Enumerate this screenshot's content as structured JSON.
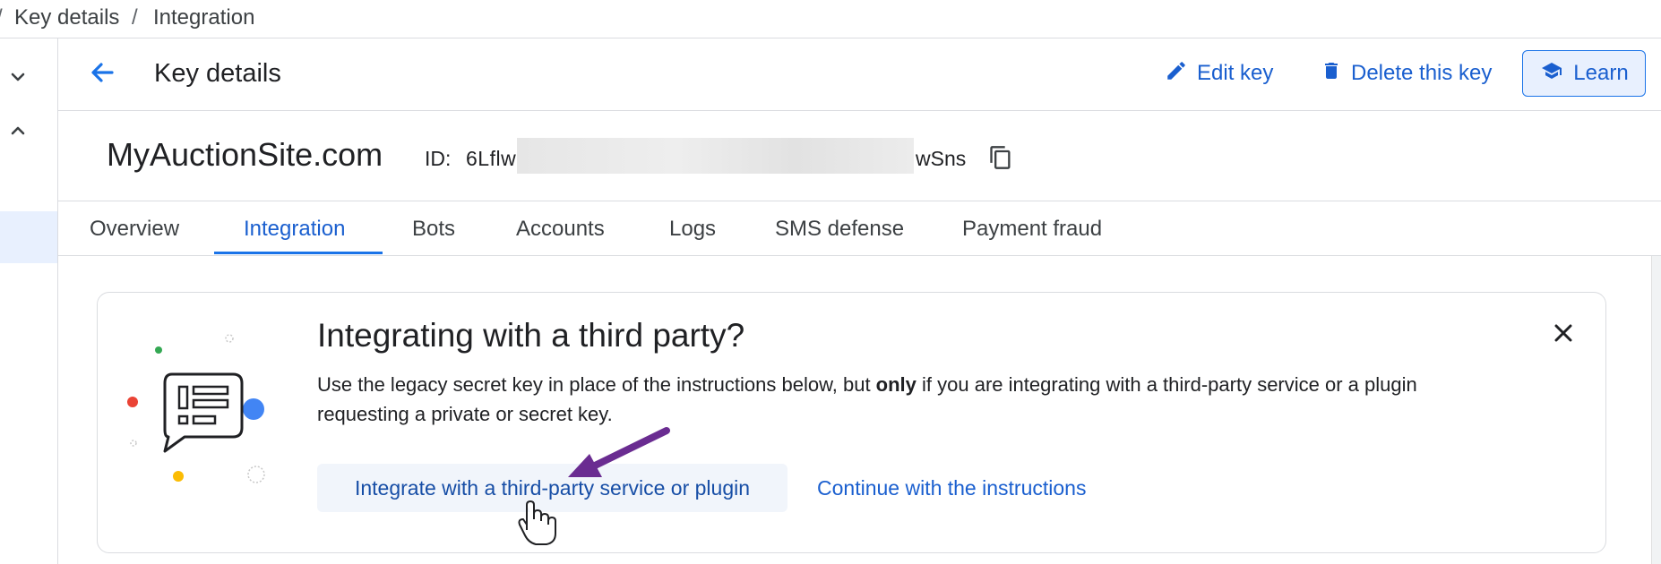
{
  "breadcrumb": {
    "edge": "/",
    "items": [
      "Key details",
      "Integration"
    ],
    "separator": "/"
  },
  "header": {
    "title": "Key details",
    "edit_label": "Edit key",
    "delete_label": "Delete this key",
    "learn_label": "Learn"
  },
  "key": {
    "site_name": "MyAuctionSite.com",
    "id_label": "ID:",
    "id_prefix": "6Lflw",
    "id_suffix": "wSns"
  },
  "tabs": [
    {
      "label": "Overview"
    },
    {
      "label": "Integration"
    },
    {
      "label": "Bots"
    },
    {
      "label": "Accounts"
    },
    {
      "label": "Logs"
    },
    {
      "label": "SMS defense"
    },
    {
      "label": "Payment fraud"
    }
  ],
  "active_tab": "Integration",
  "callout": {
    "title": "Integrating with a third party?",
    "body_pre": "Use the legacy secret key in place of the instructions below, but ",
    "body_bold": "only",
    "body_post": " if you are integrating with a third-party service or a plugin requesting a private or secret key.",
    "primary_label": "Integrate with a third-party service or plugin",
    "secondary_label": "Continue with the instructions"
  },
  "icons": {
    "rail_top": "chevron-down-icon",
    "rail_second": "chevron-up-icon",
    "back": "arrow-back-icon",
    "edit": "pencil-icon",
    "delete": "trash-icon",
    "learn": "school-cap-icon",
    "copy": "copy-icon",
    "close": "close-icon",
    "illustration": "chat-bubble-list-icon"
  },
  "colors": {
    "accent": "#1a73e8",
    "link": "#1a5fcf",
    "annotation_arrow": "#6a2c91"
  }
}
